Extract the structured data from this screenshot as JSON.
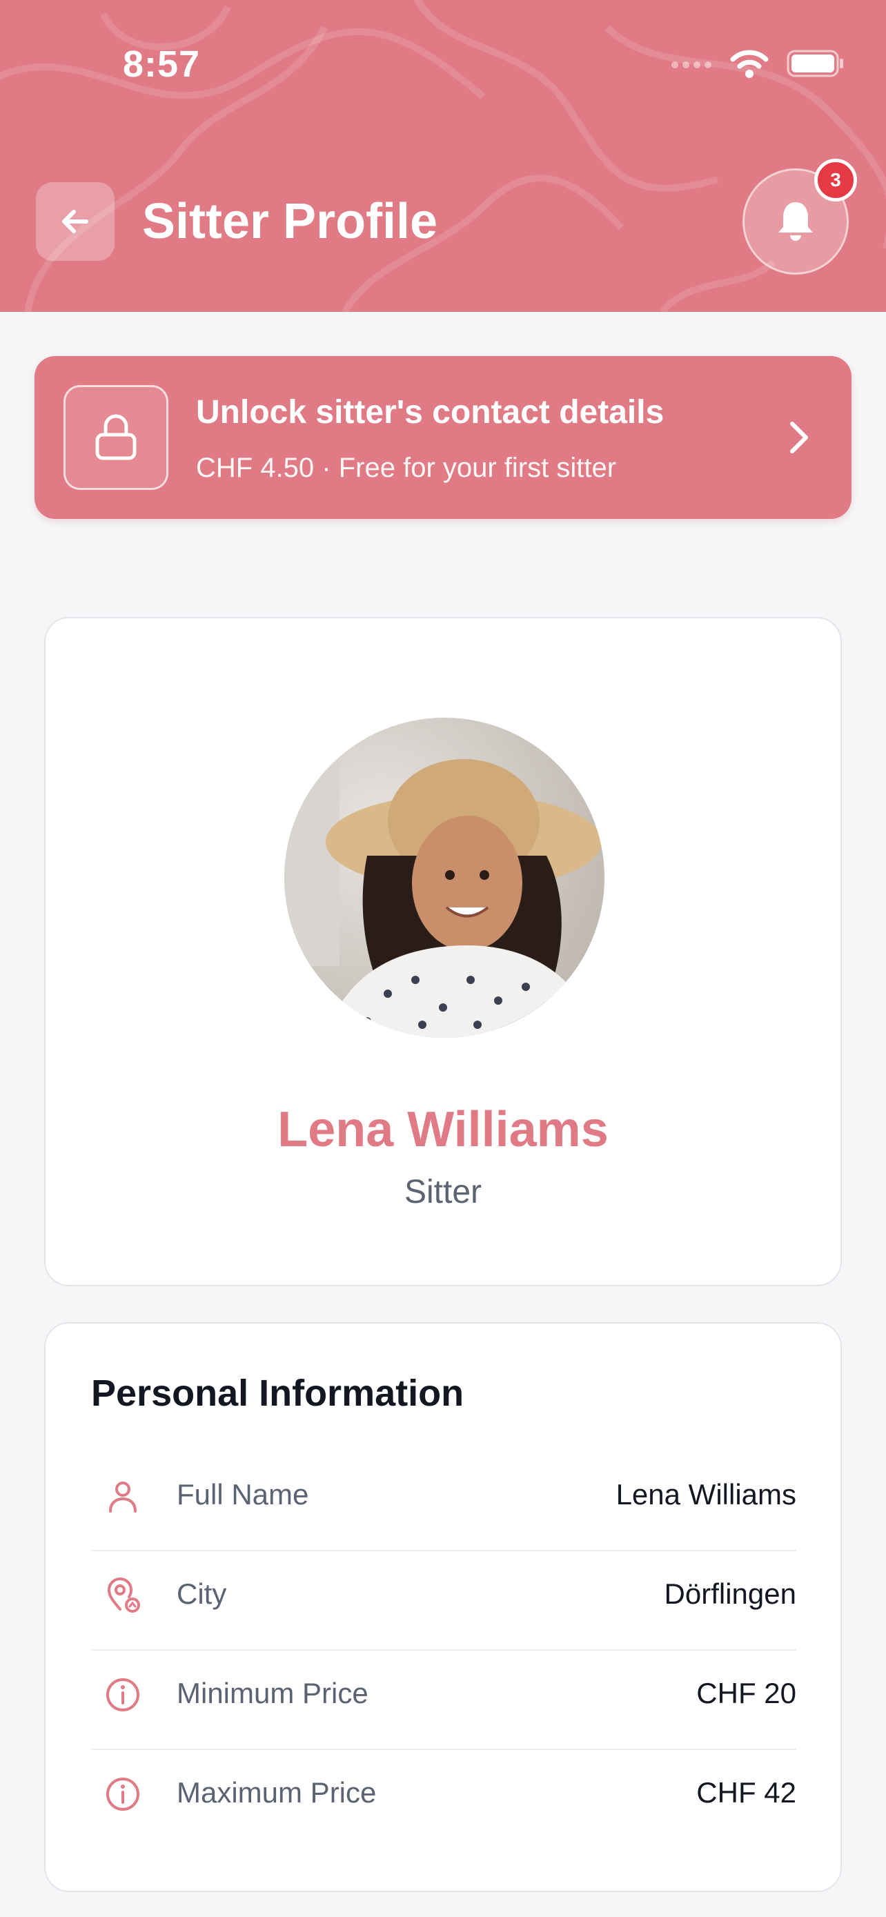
{
  "status_bar": {
    "time": "8:57"
  },
  "header": {
    "title": "Sitter Profile",
    "notification_count": "3"
  },
  "unlock_banner": {
    "title": "Unlock sitter's contact details",
    "subtitle": "CHF 4.50 · Free for your first sitter"
  },
  "profile": {
    "name": "Lena Williams",
    "role": "Sitter"
  },
  "personal_info": {
    "title": "Personal Information",
    "rows": [
      {
        "icon": "user-icon",
        "label": "Full Name",
        "value": "Lena Williams"
      },
      {
        "icon": "location-pin-icon",
        "label": "City",
        "value": "Dörflingen"
      },
      {
        "icon": "info-icon",
        "label": "Minimum Price",
        "value": "CHF 20"
      },
      {
        "icon": "info-icon",
        "label": "Maximum Price",
        "value": "CHF 42"
      }
    ]
  },
  "colors": {
    "accent": "#e07a85",
    "badge": "#e53945",
    "text": "#131722",
    "muted": "#5b6272"
  }
}
